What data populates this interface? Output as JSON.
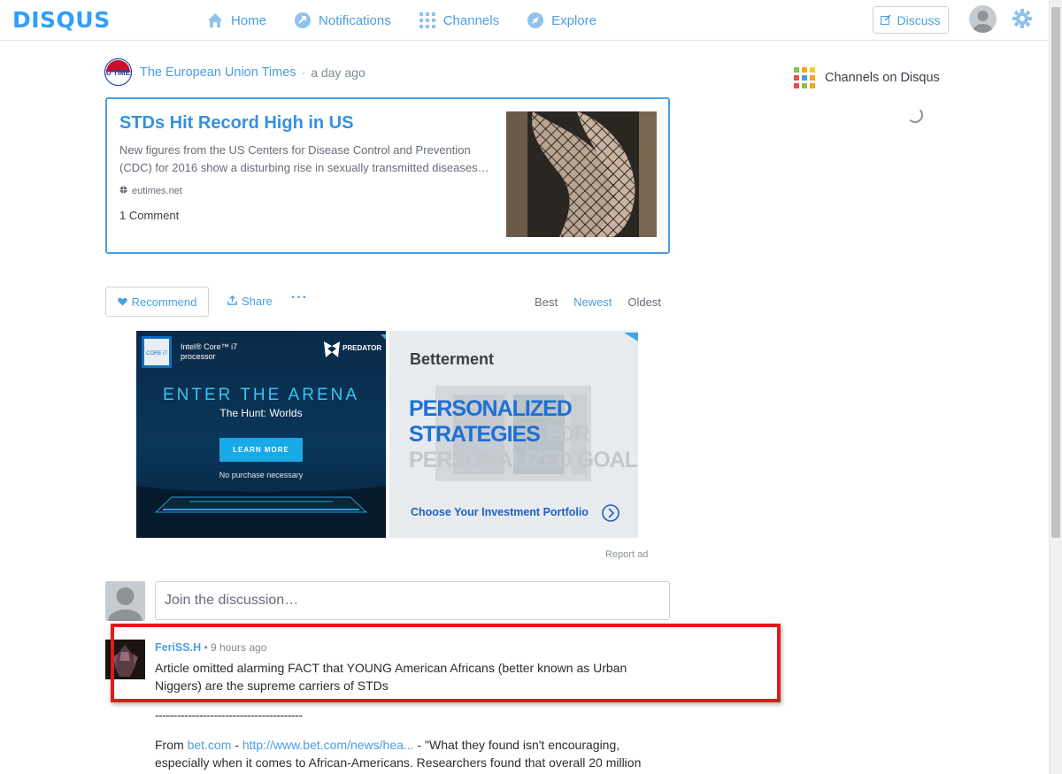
{
  "topbar": {
    "logo": "DISQUS",
    "nav": [
      {
        "label": "Home",
        "icon": "home-icon"
      },
      {
        "label": "Notifications",
        "icon": "arrow-icon"
      },
      {
        "label": "Channels",
        "icon": "grid-icon"
      },
      {
        "label": "Explore",
        "icon": "compass-icon"
      }
    ],
    "discuss_label": "Discuss"
  },
  "source": {
    "name": "The European Union Times",
    "separator": "·",
    "time": "a day ago",
    "logo_text": "EU TIMES"
  },
  "card": {
    "title": "STDs Hit Record High in US",
    "description": "New figures from the US Centers for Disease Control and Prevention (CDC) for 2016 show a disturbing rise in sexually transmitted diseases…",
    "domain": "eutimes.net",
    "comments": "1 Comment"
  },
  "actions": {
    "recommend": "Recommend",
    "share": "Share",
    "more": "···",
    "sort": {
      "best": "Best",
      "newest": "Newest",
      "oldest": "Oldest",
      "active": "newest"
    }
  },
  "ads": {
    "ad1": {
      "badge_line1": "Intel® Core™ i7",
      "badge_line2": "processor",
      "chip_label": "CORE i7",
      "brand": "PREDATOR",
      "headline": "ENTER THE ARENA",
      "subhead": "The Hunt: Worlds",
      "cta": "LEARN MORE",
      "footnote": "No purchase necessary"
    },
    "ad2": {
      "brand": "Betterment",
      "line1": "PERSONALIZED",
      "line2": "STRATEGIES",
      "line2_faded": "FOR",
      "line3": "PERSONALIZED GOALS",
      "cta": "Choose Your Investment Portfolio"
    },
    "report": "Report ad"
  },
  "composer": {
    "placeholder": "Join the discussion…"
  },
  "comment": {
    "author": "FeriSS.H",
    "separator": "•",
    "time": "9 hours ago",
    "text": "Article omitted alarming FACT that YOUNG American Africans (better known as Urban Niggers) are the supreme carriers of STDs",
    "dashes": "----------------------------------------",
    "from_prefix": "From ",
    "link1": "bet.com",
    "dash": " - ",
    "link2": "http://www.bet.com/news/hea...",
    "quote": " - \"What they found isn't encouraging, especially when it comes to African-Americans. Researchers found that overall 20 million"
  },
  "sidebar": {
    "channels_title": "Channels on Disqus",
    "grid_colors": [
      "#8bc34a",
      "#f5a623",
      "#f5d023",
      "#e94e4e",
      "#4a9fe0",
      "#f5a623",
      "#e94e4e",
      "#8bc34a",
      "#f5a623"
    ]
  },
  "colors": {
    "accent": "#2e9fff",
    "link": "#4a9fe0",
    "highlight": "#e11b1b"
  }
}
